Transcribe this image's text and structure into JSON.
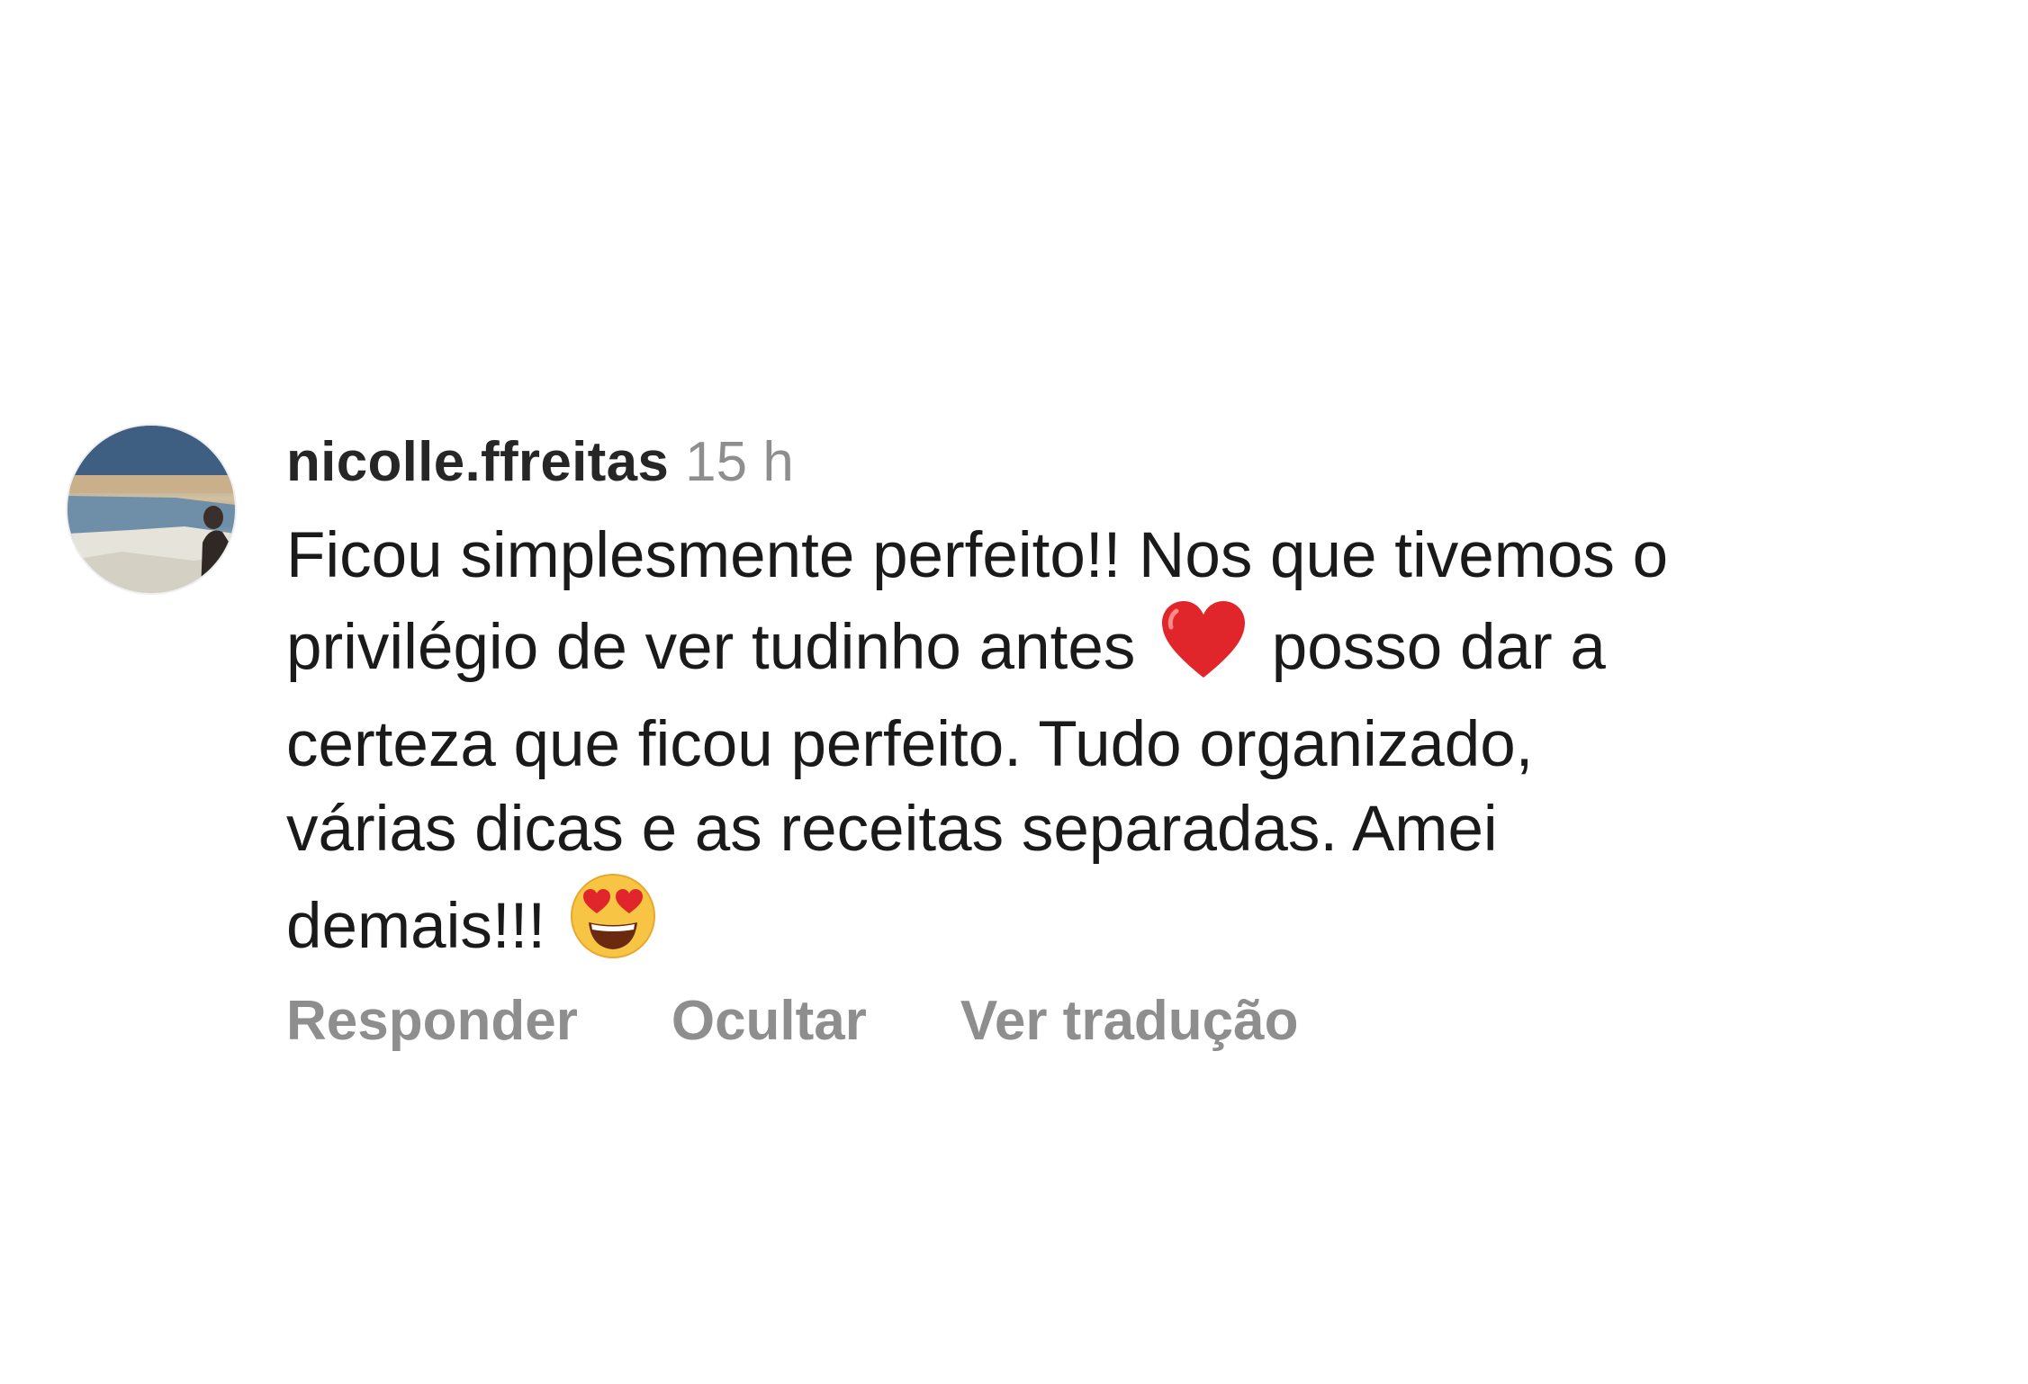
{
  "comment": {
    "username": "nicolle.ffreitas",
    "time": "15 h",
    "text_line_1": "Ficou simplesmente perfeito!! Nos que tivemos o",
    "text_line_2_a": "privilégio de ver tudinho antes",
    "text_line_2_b": "posso dar a",
    "text_line_3": "certeza que ficou perfeito. Tudo organizado,",
    "text_line_4": "várias dicas e as receitas separadas. Amei",
    "text_line_5": "demais!!!",
    "emoji_1": "red-heart-emoji",
    "emoji_2": "heart-eyes-emoji"
  },
  "actions": {
    "reply_label": "Responder",
    "hide_label": "Ocultar",
    "translate_label": "Ver tradução"
  },
  "colors": {
    "primary_text": "#1a1a1a",
    "secondary_text": "#8e8e8e",
    "heart": "#e0262b",
    "emoji_face": "#f7c543"
  }
}
